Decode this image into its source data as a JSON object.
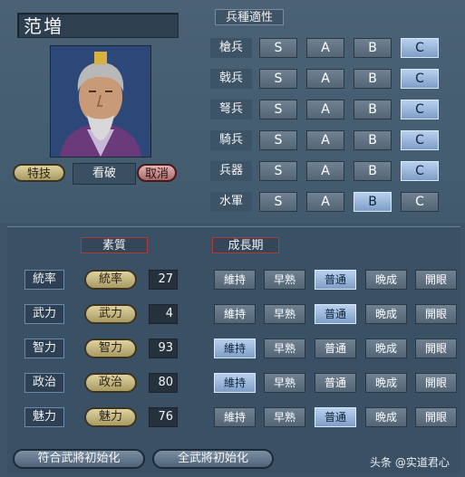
{
  "officer": {
    "name": "范増",
    "skill_button": "特技",
    "skill_name": "看破",
    "cancel_button": "取消"
  },
  "aptitude": {
    "title": "兵種適性",
    "grade_labels": [
      "S",
      "A",
      "B",
      "C"
    ],
    "rows": [
      {
        "label": "槍兵",
        "selected": "C"
      },
      {
        "label": "戟兵",
        "selected": "C"
      },
      {
        "label": "弩兵",
        "selected": "C"
      },
      {
        "label": "騎兵",
        "selected": "C"
      },
      {
        "label": "兵器",
        "selected": "C"
      },
      {
        "label": "水軍",
        "selected": "B"
      }
    ]
  },
  "stats": {
    "section_title": "素質",
    "growth_title": "成長期",
    "growth_options": [
      "維持",
      "早熟",
      "普通",
      "晩成",
      "開眼"
    ],
    "rows": [
      {
        "label": "統率",
        "button": "統率",
        "value": "27",
        "growth": "普通"
      },
      {
        "label": "武力",
        "button": "武力",
        "value": "4",
        "growth": "普通"
      },
      {
        "label": "智力",
        "button": "智力",
        "value": "93",
        "growth": "維持"
      },
      {
        "label": "政治",
        "button": "政治",
        "value": "80",
        "growth": "維持"
      },
      {
        "label": "魅力",
        "button": "魅力",
        "value": "76",
        "growth": "普通"
      }
    ]
  },
  "footer": {
    "reset_matching": "符合武將初始化",
    "reset_all": "全武將初始化"
  },
  "watermark": "头条 @实道君心"
}
